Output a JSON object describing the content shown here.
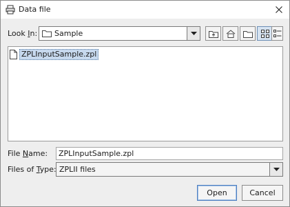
{
  "window": {
    "title": "Data file"
  },
  "look_in": {
    "label_prefix": "Look ",
    "label_mnemonic": "I",
    "label_suffix": "n:",
    "value": "Sample"
  },
  "toolbar": {
    "buttons": [
      {
        "name": "up-one-level"
      },
      {
        "name": "home"
      },
      {
        "name": "new-folder"
      },
      {
        "name": "list-view",
        "active": true
      },
      {
        "name": "details-view",
        "active": false
      }
    ]
  },
  "files": [
    {
      "name": "ZPLInputSample.zpl",
      "selected": true
    }
  ],
  "file_name": {
    "label_prefix": "File ",
    "label_mnemonic": "N",
    "label_suffix": "ame:",
    "value": "ZPLInputSample.zpl"
  },
  "file_type": {
    "label_prefix": "Files of ",
    "label_mnemonic": "T",
    "label_suffix": "ype:",
    "value": "ZPLII files"
  },
  "buttons": {
    "open": "Open",
    "cancel": "Cancel"
  },
  "colors": {
    "selection": "#c7d9ee",
    "default_button_border": "#4f7fbf",
    "window_bg": "#eeeeee"
  }
}
